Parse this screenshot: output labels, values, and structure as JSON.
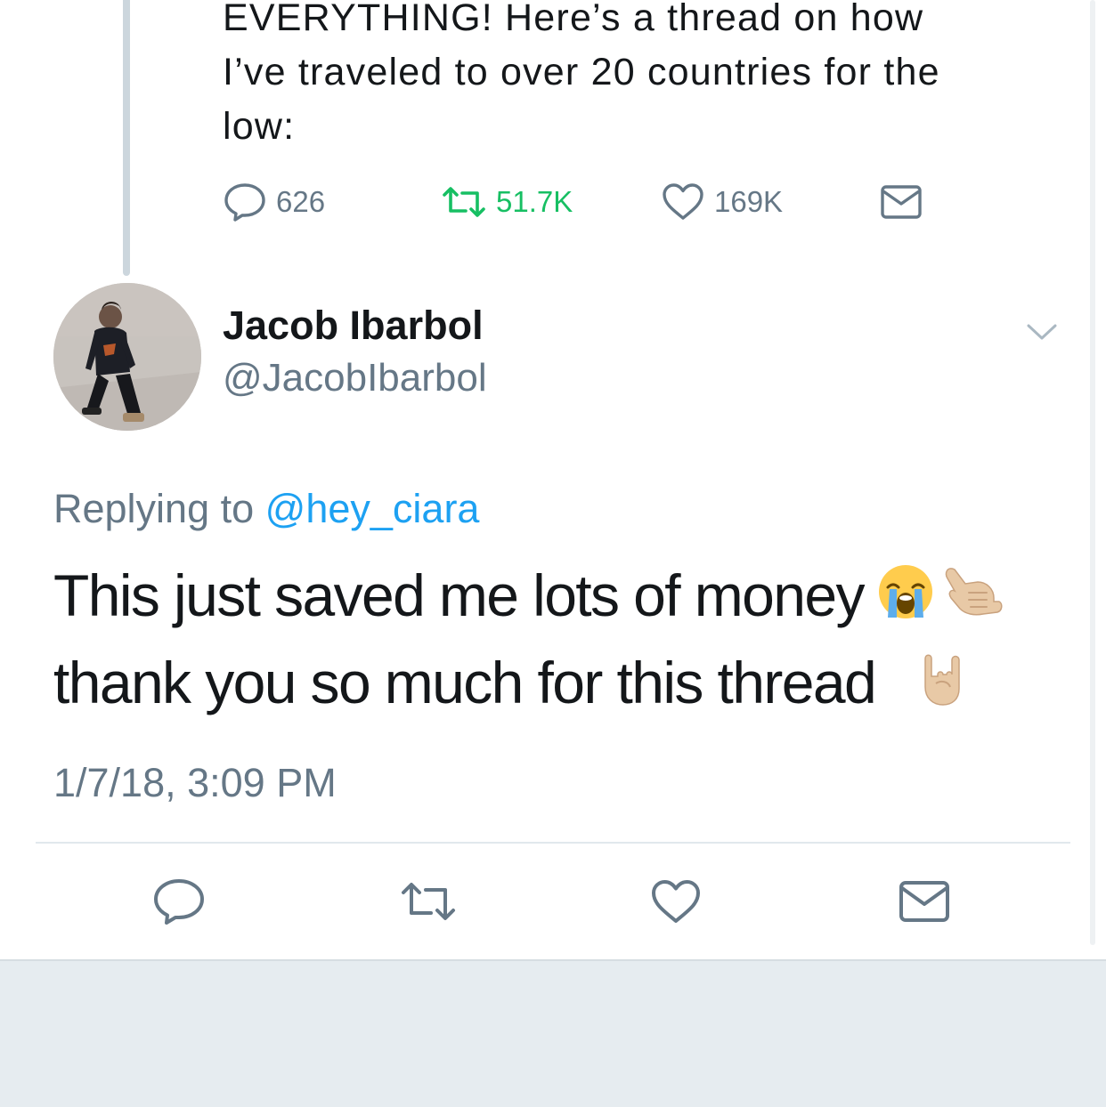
{
  "parent_tweet": {
    "text_lines": [
      "EVERYTHING! Here’s a thread on how",
      "I’ve traveled to over 20 countries for the",
      "low:"
    ],
    "replies_count": "626",
    "retweets_count": "51.7K",
    "likes_count": "169K"
  },
  "tweet": {
    "author_name": "Jacob Ibarbol",
    "author_handle": "@JacobIbarbol",
    "replying_prefix": "Replying to",
    "replying_to": "@hey_ciara",
    "body_line_1": "This just saved me lots of money",
    "body_line_2": "thank you so much for this thread",
    "emojis": [
      "loudly-crying-face",
      "call-me-hand",
      "sign-of-the-horns"
    ],
    "timestamp": "1/7/18, 3:09 PM"
  },
  "icons": {
    "reply": "reply-icon",
    "retweet": "retweet-icon",
    "like": "heart-icon",
    "dm": "envelope-icon",
    "menu": "chevron-down-icon"
  },
  "colors": {
    "text": "#14171a",
    "secondary": "#657786",
    "link": "#1da1f2",
    "retweet_active": "#17bf63",
    "divider": "#e1e8ed",
    "thread_line": "#ccd6dd",
    "footer_bg": "#e6ecf0"
  }
}
